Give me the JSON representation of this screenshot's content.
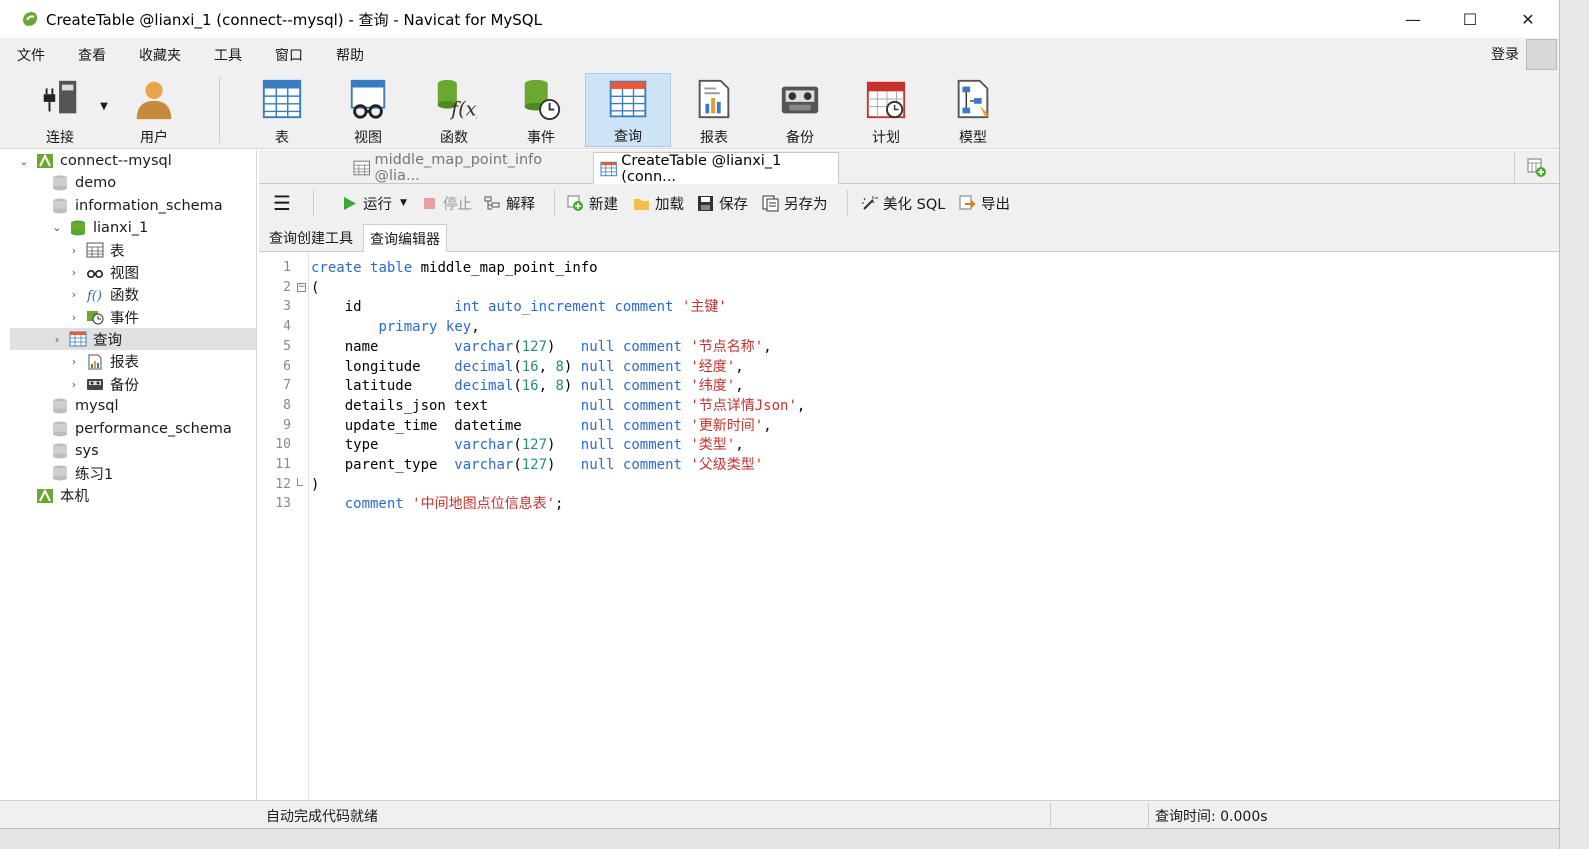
{
  "window": {
    "title": "CreateTable @lianxi_1 (connect--mysql) - 查询 - Navicat for MySQL",
    "minimize": "—",
    "maximize": "☐",
    "close": "✕"
  },
  "menu": {
    "items": [
      "文件",
      "查看",
      "收藏夹",
      "工具",
      "窗口",
      "帮助"
    ],
    "login": "登录"
  },
  "toolbar": {
    "items": [
      {
        "label": "连接",
        "icon": "plug-icon"
      },
      {
        "label": "用户",
        "icon": "user-icon"
      },
      {
        "label": "表",
        "icon": "table-icon"
      },
      {
        "label": "视图",
        "icon": "view-icon"
      },
      {
        "label": "函数",
        "icon": "function-icon"
      },
      {
        "label": "事件",
        "icon": "event-icon"
      },
      {
        "label": "查询",
        "icon": "query-icon",
        "selected": true
      },
      {
        "label": "报表",
        "icon": "report-icon"
      },
      {
        "label": "备份",
        "icon": "backup-icon"
      },
      {
        "label": "计划",
        "icon": "schedule-icon"
      },
      {
        "label": "模型",
        "icon": "model-icon"
      }
    ]
  },
  "tree": {
    "nodes": [
      {
        "label": "connect--mysql",
        "level": 0,
        "expanded": true,
        "icon": "connection-icon"
      },
      {
        "label": "demo",
        "level": 1,
        "icon": "database-icon"
      },
      {
        "label": "information_schema",
        "level": 1,
        "icon": "database-icon"
      },
      {
        "label": "lianxi_1",
        "level": 1,
        "expanded": true,
        "icon": "database-open-icon"
      },
      {
        "label": "表",
        "level": 2,
        "icon": "table-icon"
      },
      {
        "label": "视图",
        "level": 2,
        "icon": "view-icon"
      },
      {
        "label": "函数",
        "level": 2,
        "icon": "function-icon"
      },
      {
        "label": "事件",
        "level": 2,
        "icon": "event-icon"
      },
      {
        "label": "查询",
        "level": 2,
        "icon": "query-icon",
        "selected": true
      },
      {
        "label": "报表",
        "level": 2,
        "icon": "report-icon"
      },
      {
        "label": "备份",
        "level": 2,
        "icon": "backup-icon"
      },
      {
        "label": "mysql",
        "level": 1,
        "icon": "database-icon"
      },
      {
        "label": "performance_schema",
        "level": 1,
        "icon": "database-icon"
      },
      {
        "label": "sys",
        "level": 1,
        "icon": "database-icon"
      },
      {
        "label": "练习1",
        "level": 1,
        "icon": "database-icon"
      },
      {
        "label": "本机",
        "level": 0,
        "icon": "connection-icon"
      }
    ]
  },
  "tabs": [
    {
      "label": "middle_map_point_info @lia...",
      "active": false
    },
    {
      "label": "CreateTable @lianxi_1 (conn...",
      "active": true
    }
  ],
  "query_toolbar": {
    "run": "运行",
    "stop": "停止",
    "explain": "解释",
    "new": "新建",
    "load": "加载",
    "save": "保存",
    "save_as": "另存为",
    "beautify": "美化 SQL",
    "export": "导出"
  },
  "subtabs": [
    "查询创建工具",
    "查询编辑器"
  ],
  "editor": {
    "line_numbers": [
      "1",
      "2",
      "3",
      "4",
      "5",
      "6",
      "7",
      "8",
      "9",
      "10",
      "11",
      "12",
      "13"
    ],
    "lines": [
      "create table middle_map_point_info",
      "(",
      "    id           int auto_increment comment '主键'",
      "        primary key,",
      "    name         varchar(127)   null comment '节点名称',",
      "    longitude    decimal(16, 8) null comment '经度',",
      "    latitude     decimal(16, 8) null comment '纬度',",
      "    details_json text           null comment '节点详情Json',",
      "    update_time  datetime       null comment '更新时间',",
      "    type         varchar(127)   null comment '类型',",
      "    parent_type  varchar(127)   null comment '父级类型'",
      ")",
      "    comment '中间地图点位信息表';"
    ]
  },
  "status": {
    "left": "自动完成代码就绪",
    "right": "查询时间: 0.000s"
  },
  "colors": {
    "keyword": "#2a6bd1",
    "string": "#c8322e",
    "selected": "#cde4f7"
  }
}
